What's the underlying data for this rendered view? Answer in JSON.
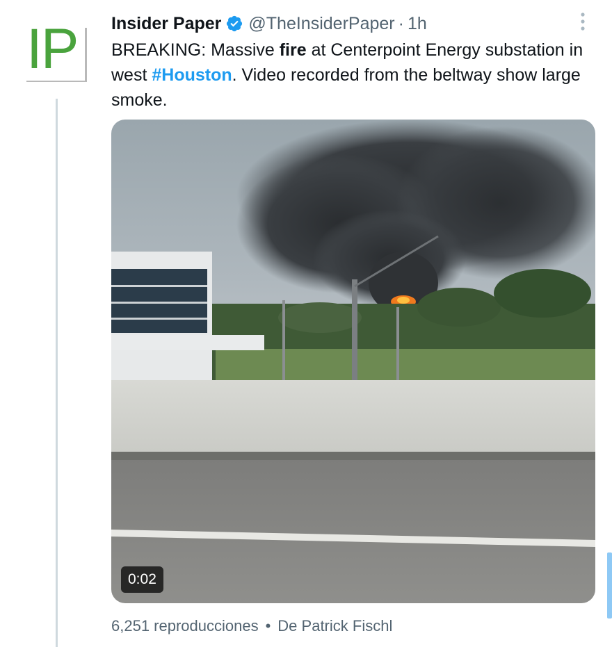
{
  "author": {
    "avatar_text": "IP",
    "display_name": "Insider Paper",
    "handle": "@TheInsiderPaper",
    "separator": "·",
    "time": "1h",
    "verified": true
  },
  "tweet": {
    "text_1": "BREAKING: Massive ",
    "highlight": "fire",
    "text_2": " at Centerpoint Energy substation in west ",
    "hashtag": "#Houston",
    "text_3": ". Video recorded from the beltway show large smoke."
  },
  "video": {
    "duration": "0:02",
    "description": "Highway view of a large black smoke plume with fire at an energy substation"
  },
  "meta": {
    "views": "6,251 reproducciones",
    "separator": "•",
    "credit": "De Patrick Fischl"
  },
  "colors": {
    "avatar_green": "#4aa33d",
    "verified_blue": "#1d9bf0",
    "link_blue": "#1d9bf0",
    "secondary_text": "#536471",
    "primary_text": "#0f1419",
    "thread_line": "#cfd9de"
  },
  "icons": {
    "verified": "verified-badge-icon",
    "more": "more-vertical-icon"
  }
}
